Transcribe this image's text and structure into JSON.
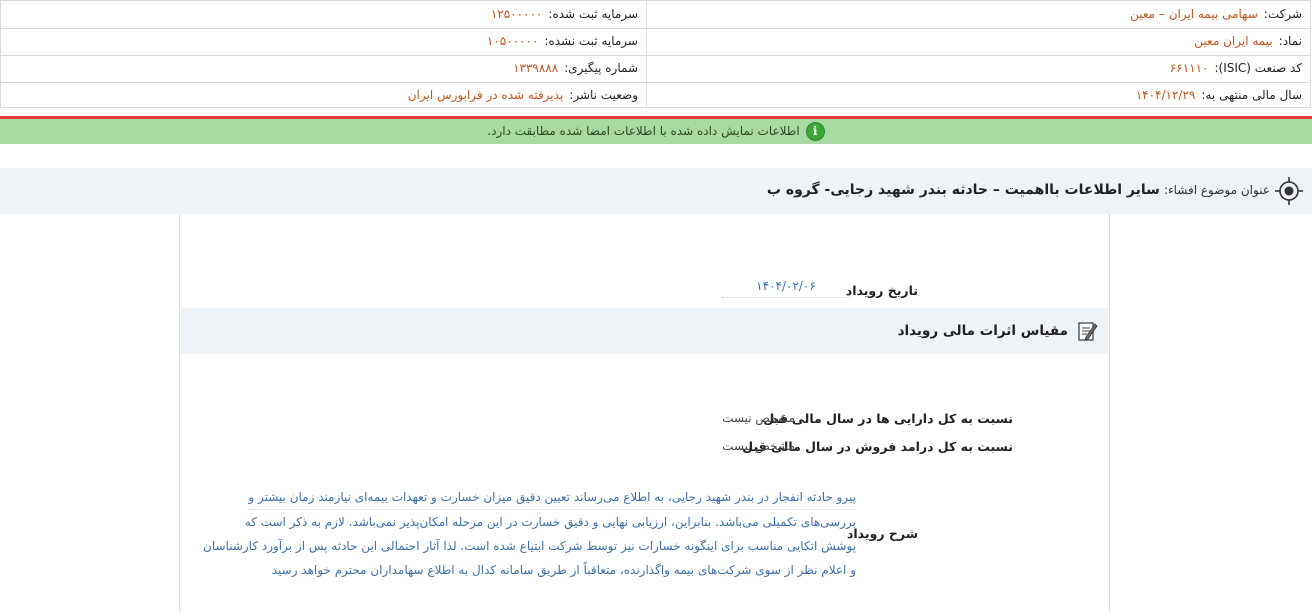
{
  "header": {
    "company_label": "شرکت:",
    "company_value": "سهامی بیمه ایران – معین",
    "symbol_label": "نماد:",
    "symbol_value": "بیمه ایران معین",
    "isic_label": "کد صنعت (ISIC):",
    "isic_value": "۶۶۱۱۱۰",
    "fiscal_label": "سال مالی منتهی به:",
    "fiscal_value": "۱۴۰۴/۱۲/۲۹",
    "reg_capital_label": "سرمایه ثبت شده:",
    "reg_capital_value": "۱۲۵۰۰۰۰۰",
    "unreg_capital_label": "سرمایه ثبت نشده:",
    "unreg_capital_value": "۱۰۵۰۰۰۰۰",
    "tracking_label": "شماره پیگیری:",
    "tracking_value": "۱۳۳۹۸۸۸",
    "publisher_label": "وضعیت ناشر:",
    "publisher_value": "پذیرفته شده در فرابورس ایران"
  },
  "banner": {
    "text": "اطلاعات نمایش داده شده با اطلاعات امضا شده مطابقت دارد."
  },
  "subject": {
    "label": "عنوان موضوع افشاء:",
    "value": "سایر اطلاعات بااهمیت – حادثه بندر شهید رجایی- گروه ب"
  },
  "event": {
    "date_label": "تاریخ رویداد",
    "date_value": "۱۴۰۴/۰۲/۰۶",
    "impact_title": "مقیاس اثرات مالی رویداد",
    "assets_label": "نسبت به کل دارایی ها در سال مالی قبل",
    "assets_value": "مشخص نیست",
    "revenue_label": "نسبت به کل درامد فروش در سال مالی قبل",
    "revenue_value": "مشخص نیست",
    "desc_label": "شرح رویداد",
    "desc_lines": [
      "پیرو حادثه انفجار در بندر شهید رجایی، به اطلاع می‌رساند تعیین دقیق میزان خسارت و تعهدات بیمه‌ای نیازمند زمان بیشتر و",
      "بررسی‌های تکمیلی می‌باشد. بنابراین، ارزیابی نهایی و دقیق خسارت در این مرحله امکان‌پذیر نمی‌باشد. لازم به ذکر است که",
      "پوشش اتکایی مناسب برای اینگونه خسارات نیز توسط شرکت ابتیاع شده است. لذا آثار احتمالی این حادثه پس از برآورد کارشناسان",
      "و اعلام نظر از سوی شرکت‌های بیمه واگذارنده، متعاقباً از طریق سامانه کدال به اطلاع سهامداران محترم خواهد رسید"
    ]
  },
  "colors": {
    "value_orange": "#c0561f",
    "banner_green": "#a9d9a3",
    "alert_red": "#e23a3a",
    "section_bg": "#eef3f8",
    "desc_blue": "#3f6fa8"
  },
  "icons": [
    "info-icon",
    "target-icon",
    "edit-note-icon"
  ]
}
